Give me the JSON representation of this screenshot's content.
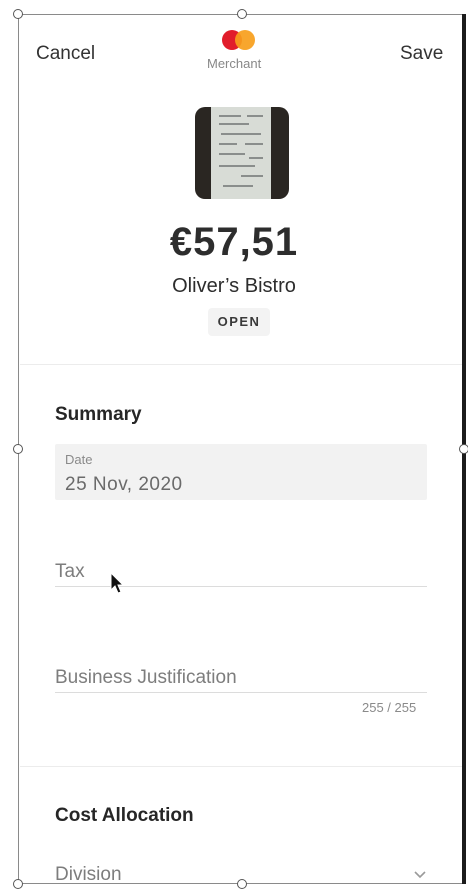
{
  "header": {
    "cancel_label": "Cancel",
    "save_label": "Save",
    "merchant_label": "Merchant"
  },
  "expense": {
    "amount": "€57,51",
    "vendor": "Oliver’s Bistro",
    "status": "OPEN"
  },
  "summary": {
    "title": "Summary",
    "date_label": "Date",
    "date_value": "25 Nov, 2020",
    "tax_placeholder": "Tax",
    "justification_placeholder": "Business Justification",
    "justification_counter": "255 / 255"
  },
  "cost_allocation": {
    "title": "Cost Allocation",
    "division_placeholder": "Division"
  },
  "colors": {
    "mastercard_red": "#e11d2b",
    "mastercard_orange": "#f79e1b"
  },
  "icons": [
    "mastercard-logo-icon",
    "chevron-down-icon",
    "mouse-cursor-icon"
  ]
}
